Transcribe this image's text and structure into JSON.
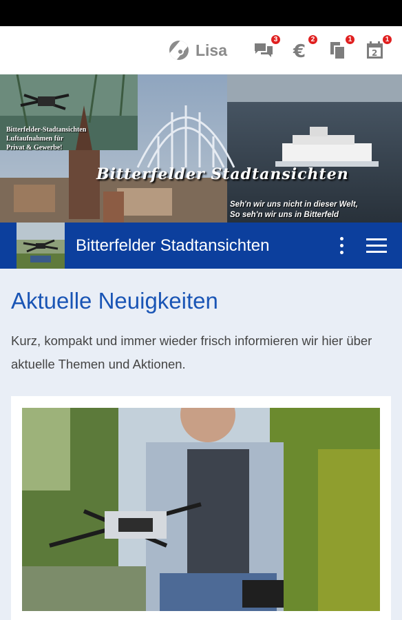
{
  "topbar": {
    "user_name": "Lisa",
    "icons": [
      {
        "name": "chat-icon",
        "badge": "3"
      },
      {
        "name": "euro-icon",
        "badge": "2"
      },
      {
        "name": "documents-icon",
        "badge": "1"
      },
      {
        "name": "calendar-icon",
        "badge": "1",
        "day": "2"
      }
    ]
  },
  "banner": {
    "side_text_1": "Bitterfelder-Stadtansichten",
    "side_text_2": "Luftaufnahmen für",
    "side_text_3": "Privat & Gewerbe!",
    "title": "Bitterfelder Stadtansichten",
    "slogan_1": "Seh'n wir uns nicht in dieser Welt,",
    "slogan_2": "So seh'n wir uns in Bitterfeld"
  },
  "navbar": {
    "title": "Bitterfelder Stadtansichten",
    "more_icon": "more-vert-icon",
    "menu_icon": "hamburger-menu-icon"
  },
  "content": {
    "heading": "Aktuelle Neuigkeiten",
    "intro": "Kurz, kompakt und immer wieder frisch informieren wir hier über aktuelle Themen und Aktionen."
  },
  "colors": {
    "navbar": "#0c3f9d",
    "heading": "#1a55b5",
    "background": "#e9eef6",
    "badge": "#e02020"
  }
}
